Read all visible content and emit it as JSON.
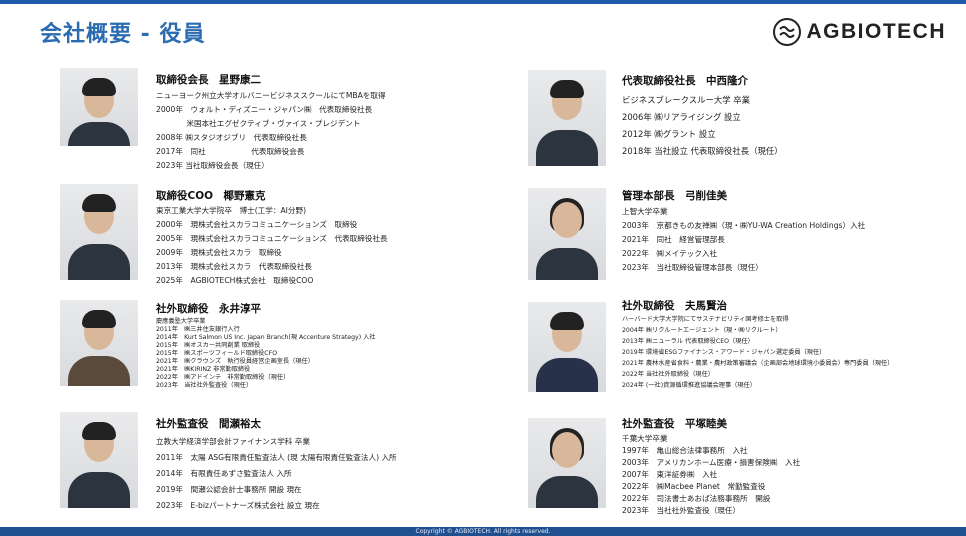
{
  "header": {
    "title": "会社概要 - 役員",
    "brand": "AGBIOTECH",
    "accent_color": "#2b6cb0"
  },
  "footer": {
    "copyright": "Copyright © AGBIOTECH. All rights reserved."
  },
  "people": [
    {
      "title": "取締役会長　星野康二",
      "lines": [
        "ニューヨーク州立大学オルバニービジネススクールにてMBAを取得",
        "2000年　ウォルト・ディズニー・ジャパン㈱　代表取締役社長",
        "　　　　米国本社エグゼクティブ・ヴァイス・プレジデント",
        "2008年 ㈱スタジオジブリ　代表取締役社長",
        "2017年　同社　　　　　　代表取締役会長",
        "2023年 当社取締役会長（現任）"
      ]
    },
    {
      "title": "取締役COO　椰野憲克",
      "lines": [
        "東京工業大学大学院卒　博士(工学：AI分野)",
        "2000年　現株式会社スカラコミュニケーションズ　取締役",
        "2005年　現株式会社スカラコミュニケーションズ　代表取締役社長",
        "2009年　現株式会社スカラ　取締役",
        "2013年　現株式会社スカラ　代表取締役社長",
        "2025年　AGBIOTECH株式会社　取締役COO"
      ]
    },
    {
      "title": "社外取締役　永井淳平",
      "lines": [
        "慶應義塾大学卒業",
        "2011年　㈱三井住友銀行入行",
        "2014年　Kurt Salmon US Inc. Japan Branch(現 Accenture Strategy) 入社",
        "2015年　㈱オスカー共同創業 取締役",
        "2015年　㈱スポーツフィールド取締役CFO",
        "2021年　㈱クラウンズ　執行役員経営企画室長（現任）",
        "2021年　㈱KIRINZ 非常勤取締役",
        "2022年　㈱アドインテ　非常勤取締役（現任）",
        "2023年　当社社外監査役（現任）"
      ]
    },
    {
      "title": "社外監査役　間瀬裕太",
      "lines": [
        "立教大学経済学部会計ファイナンス学科 卒業",
        "2011年　太陽 ASG有限責任監査法人 (現 太陽有限責任監査法人) 入所",
        "2014年　有限責任あずさ監査法人 入所",
        "2019年　間瀬公認会計士事務所 開設 現在",
        "2023年　E-bizパートナーズ株式会社 設立 現在"
      ]
    },
    {
      "title": "代表取締役社長　中西隆介",
      "lines": [
        "ビジネスブレークスルー大学 卒業",
        "2006年 ㈱リアライジング 設立",
        "2012年 ㈱グラント 設立",
        "2018年 当社設立 代表取締役社長（現任）"
      ]
    },
    {
      "title": "管理本部長　弓削佳美",
      "lines": [
        "上智大学卒業",
        "2003年　京都きもの友禅㈱（現・㈱YU-WA Creation Holdings）入社",
        "2021年　同社　経営管理部長",
        "2022年　㈱メイテック入社",
        "2023年　当社取締役管理本部長（現任）"
      ]
    },
    {
      "title": "社外取締役　夫馬賢治",
      "lines": [
        "ハーバード大学大学院にてサステナビリティ国考修士を取得",
        "2004年 ㈱リクルートエージェント（現・㈱リクルート）",
        "2013年 ㈱ニューラル 代表取締役CEO（現任）",
        "2019年 環境省ESGファイナンス・アワード・ジャパン選定委員（現任）",
        "2021年 農林水産省食料・農業・農村政策審議会（企画部会地球環境小委員会）専門委員（現任）",
        "2022年 当社社外取締役（現任）",
        "2024年 (一社)資源循環推進協議会理事（現任）"
      ]
    },
    {
      "title": "社外監査役　平塚睦美",
      "lines": [
        "千葉大学卒業",
        "1997年　亀山総合法律事務所　入社",
        "2003年　アメリカンホーム医療・損害保険㈱　入社",
        "2007年　東洋証券㈱　入社",
        "2022年　㈱Macbee Planet　常勤監査役",
        "2022年　司法書士あおば法務事務所　開設",
        "2023年　当社社外監査役（現任）"
      ]
    }
  ]
}
